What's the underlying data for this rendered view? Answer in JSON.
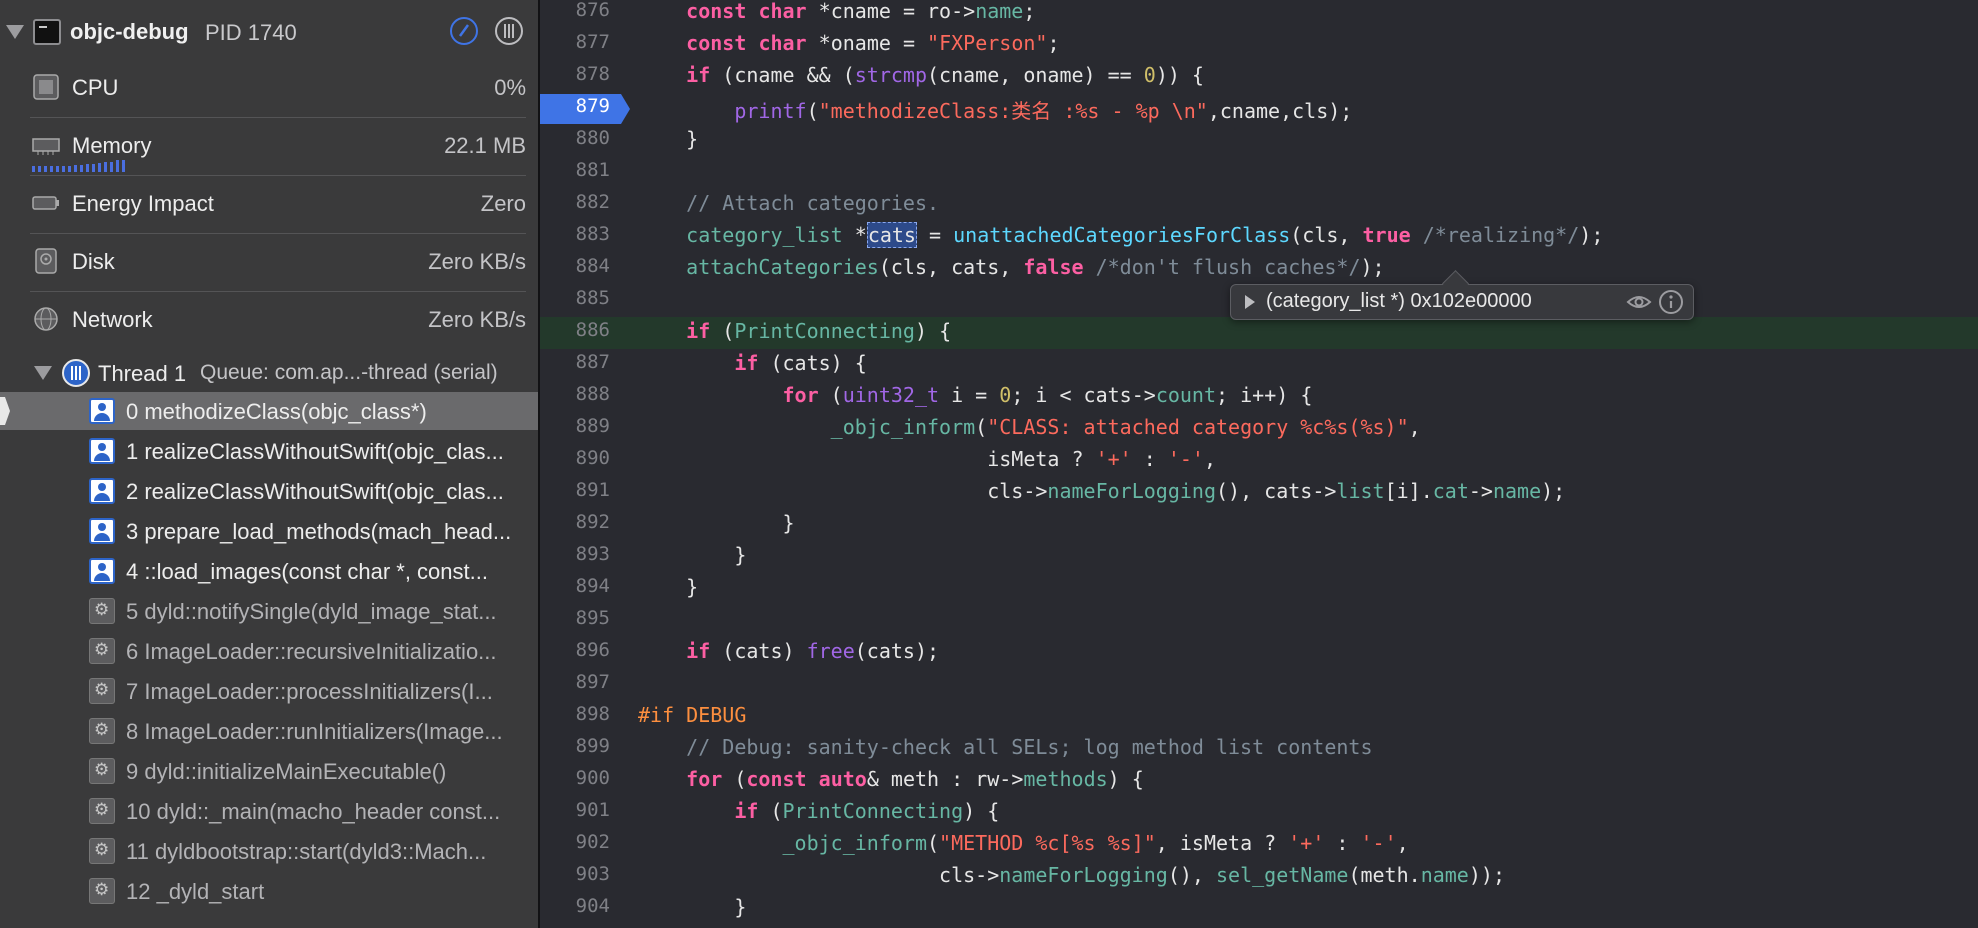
{
  "process": {
    "name": "objc-debug",
    "pid": "PID 1740"
  },
  "gauges": [
    {
      "label": "CPU",
      "value": "0%"
    },
    {
      "label": "Memory",
      "value": "22.1 MB"
    },
    {
      "label": "Energy Impact",
      "value": "Zero"
    },
    {
      "label": "Disk",
      "value": "Zero KB/s"
    },
    {
      "label": "Network",
      "value": "Zero KB/s"
    }
  ],
  "thread": {
    "label": "Thread 1",
    "queue": "Queue: com.ap...-thread (serial)"
  },
  "frames": [
    {
      "label": "0 methodizeClass(objc_class*)",
      "kind": "user",
      "selected": true
    },
    {
      "label": "1 realizeClassWithoutSwift(objc_clas...",
      "kind": "user"
    },
    {
      "label": "2 realizeClassWithoutSwift(objc_clas...",
      "kind": "user"
    },
    {
      "label": "3 prepare_load_methods(mach_head...",
      "kind": "user"
    },
    {
      "label": "4 ::load_images(const char *, const...",
      "kind": "user"
    },
    {
      "label": "5 dyld::notifySingle(dyld_image_stat...",
      "kind": "system"
    },
    {
      "label": "6 ImageLoader::recursiveInitializatio...",
      "kind": "system"
    },
    {
      "label": "7 ImageLoader::processInitializers(I...",
      "kind": "system"
    },
    {
      "label": "8 ImageLoader::runInitializers(Image...",
      "kind": "system"
    },
    {
      "label": "9 dyld::initializeMainExecutable()",
      "kind": "system"
    },
    {
      "label": "10 dyld::_main(macho_header const...",
      "kind": "system"
    },
    {
      "label": "11 dyldbootstrap::start(dyld3::Mach...",
      "kind": "system"
    },
    {
      "label": "12 _dyld_start",
      "kind": "system"
    }
  ],
  "editor": {
    "breakpoint_line": "879",
    "highlighted_line": "886",
    "lines": [
      {
        "n": "876",
        "tokens": [
          [
            "    ",
            ""
          ],
          [
            "const",
            "kw"
          ],
          [
            " ",
            ""
          ],
          [
            "char",
            "kw"
          ],
          [
            " *cname = ro->",
            ""
          ],
          [
            "name",
            "mem"
          ],
          [
            ";",
            ""
          ]
        ]
      },
      {
        "n": "877",
        "tokens": [
          [
            "    ",
            ""
          ],
          [
            "const",
            "kw"
          ],
          [
            " ",
            ""
          ],
          [
            "char",
            "kw"
          ],
          [
            " *oname = ",
            ""
          ],
          [
            "\"FXPerson\"",
            "str"
          ],
          [
            ";",
            ""
          ]
        ]
      },
      {
        "n": "878",
        "tokens": [
          [
            "    ",
            ""
          ],
          [
            "if",
            "kw"
          ],
          [
            " (cname && (",
            ""
          ],
          [
            "strcmp",
            "macro"
          ],
          [
            "(cname, oname) == ",
            ""
          ],
          [
            "0",
            "num"
          ],
          [
            ")) {",
            ""
          ]
        ]
      },
      {
        "n": "879",
        "tokens": [
          [
            "        ",
            ""
          ],
          [
            "printf",
            "macro"
          ],
          [
            "(",
            ""
          ],
          [
            "\"methodizeClass:类名 :%s - %p \\n\"",
            "str"
          ],
          [
            ",cname,cls);",
            ""
          ]
        ]
      },
      {
        "n": "880",
        "tokens": [
          [
            "    }",
            ""
          ]
        ]
      },
      {
        "n": "881",
        "tokens": []
      },
      {
        "n": "882",
        "tokens": [
          [
            "    ",
            ""
          ],
          [
            "// Attach categories.",
            "cmt"
          ]
        ]
      },
      {
        "n": "883",
        "tokens": [
          [
            "    ",
            ""
          ],
          [
            "category_list",
            "fn"
          ],
          [
            " *",
            ""
          ],
          [
            "cats",
            "sel"
          ],
          [
            " = ",
            ""
          ],
          [
            "unattachedCategoriesForClass",
            "typ"
          ],
          [
            "(cls, ",
            ""
          ],
          [
            "true",
            "kw"
          ],
          [
            " ",
            ""
          ],
          [
            "/*realizing*/",
            "cmt"
          ],
          [
            ");",
            ""
          ]
        ]
      },
      {
        "n": "884",
        "tokens": [
          [
            "    ",
            ""
          ],
          [
            "attachCategories",
            "fn"
          ],
          [
            "(cls, cats, ",
            ""
          ],
          [
            "false",
            "kw"
          ],
          [
            " ",
            ""
          ],
          [
            "/*don't flush caches*/",
            "cmt"
          ],
          [
            ");",
            ""
          ]
        ]
      },
      {
        "n": "885",
        "tokens": []
      },
      {
        "n": "886",
        "tokens": [
          [
            "    ",
            ""
          ],
          [
            "if",
            "kw"
          ],
          [
            " (",
            ""
          ],
          [
            "PrintConnecting",
            "fn"
          ],
          [
            ") {",
            ""
          ]
        ]
      },
      {
        "n": "887",
        "tokens": [
          [
            "        ",
            ""
          ],
          [
            "if",
            "kw"
          ],
          [
            " (cats) {",
            ""
          ]
        ]
      },
      {
        "n": "888",
        "tokens": [
          [
            "            ",
            ""
          ],
          [
            "for",
            "kw"
          ],
          [
            " (",
            ""
          ],
          [
            "uint32_t",
            "macro"
          ],
          [
            " i = ",
            ""
          ],
          [
            "0",
            "num"
          ],
          [
            "; i < cats->",
            ""
          ],
          [
            "count",
            "mem"
          ],
          [
            "; i++) {",
            ""
          ]
        ]
      },
      {
        "n": "889",
        "tokens": [
          [
            "                ",
            ""
          ],
          [
            "_objc_inform",
            "fn"
          ],
          [
            "(",
            ""
          ],
          [
            "\"CLASS: attached category %c%s(%s)\"",
            "str"
          ],
          [
            ",",
            ""
          ]
        ]
      },
      {
        "n": "890",
        "tokens": [
          [
            "                             isMeta ? ",
            ""
          ],
          [
            "'+'",
            "str"
          ],
          [
            " : ",
            ""
          ],
          [
            "'-'",
            "str"
          ],
          [
            ",",
            ""
          ]
        ]
      },
      {
        "n": "891",
        "tokens": [
          [
            "                             cls->",
            ""
          ],
          [
            "nameForLogging",
            "fn"
          ],
          [
            "(), cats->",
            ""
          ],
          [
            "list",
            "mem"
          ],
          [
            "[i].",
            ""
          ],
          [
            "cat",
            "mem"
          ],
          [
            "->",
            ""
          ],
          [
            "name",
            "mem"
          ],
          [
            ");",
            ""
          ]
        ]
      },
      {
        "n": "892",
        "tokens": [
          [
            "            }",
            ""
          ]
        ]
      },
      {
        "n": "893",
        "tokens": [
          [
            "        }",
            ""
          ]
        ]
      },
      {
        "n": "894",
        "tokens": [
          [
            "    }",
            ""
          ]
        ]
      },
      {
        "n": "895",
        "tokens": []
      },
      {
        "n": "896",
        "tokens": [
          [
            "    ",
            ""
          ],
          [
            "if",
            "kw"
          ],
          [
            " (cats) ",
            ""
          ],
          [
            "free",
            "macro"
          ],
          [
            "(cats);",
            ""
          ]
        ]
      },
      {
        "n": "897",
        "tokens": []
      },
      {
        "n": "898",
        "tokens": [
          [
            "#if",
            "pp"
          ],
          [
            " ",
            ""
          ],
          [
            "DEBUG",
            "pp"
          ]
        ]
      },
      {
        "n": "899",
        "tokens": [
          [
            "    ",
            ""
          ],
          [
            "// Debug: sanity-check all SELs; log method list contents",
            "cmt"
          ]
        ]
      },
      {
        "n": "900",
        "tokens": [
          [
            "    ",
            ""
          ],
          [
            "for",
            "kw"
          ],
          [
            " (",
            ""
          ],
          [
            "const",
            "kw"
          ],
          [
            " ",
            ""
          ],
          [
            "auto",
            "kw"
          ],
          [
            "& meth : rw->",
            ""
          ],
          [
            "methods",
            "mem"
          ],
          [
            ") {",
            ""
          ]
        ]
      },
      {
        "n": "901",
        "tokens": [
          [
            "        ",
            ""
          ],
          [
            "if",
            "kw"
          ],
          [
            " (",
            ""
          ],
          [
            "PrintConnecting",
            "fn"
          ],
          [
            ") {",
            ""
          ]
        ]
      },
      {
        "n": "902",
        "tokens": [
          [
            "            ",
            ""
          ],
          [
            "_objc_inform",
            "fn"
          ],
          [
            "(",
            ""
          ],
          [
            "\"METHOD %c[%s %s]\"",
            "str"
          ],
          [
            ", isMeta ? ",
            ""
          ],
          [
            "'+'",
            "str"
          ],
          [
            " : ",
            ""
          ],
          [
            "'-'",
            "str"
          ],
          [
            ",",
            ""
          ]
        ]
      },
      {
        "n": "903",
        "tokens": [
          [
            "                         cls->",
            ""
          ],
          [
            "nameForLogging",
            "fn"
          ],
          [
            "(), ",
            ""
          ],
          [
            "sel_getName",
            "fn"
          ],
          [
            "(meth.",
            ""
          ],
          [
            "name",
            "mem"
          ],
          [
            "));",
            ""
          ]
        ]
      },
      {
        "n": "904",
        "tokens": [
          [
            "        }",
            ""
          ]
        ]
      }
    ]
  },
  "tooltip": {
    "text": "(category_list *) 0x102e00000"
  },
  "icons": {
    "process": "terminal-icon",
    "debug": "debug-gauge-icon",
    "threads": "threads-icon",
    "quicklook": "eye-icon",
    "info": "info-icon"
  },
  "colors": {
    "accent": "#3f74e6",
    "background": "#292a30",
    "sidebar": "#3a3a3b"
  }
}
